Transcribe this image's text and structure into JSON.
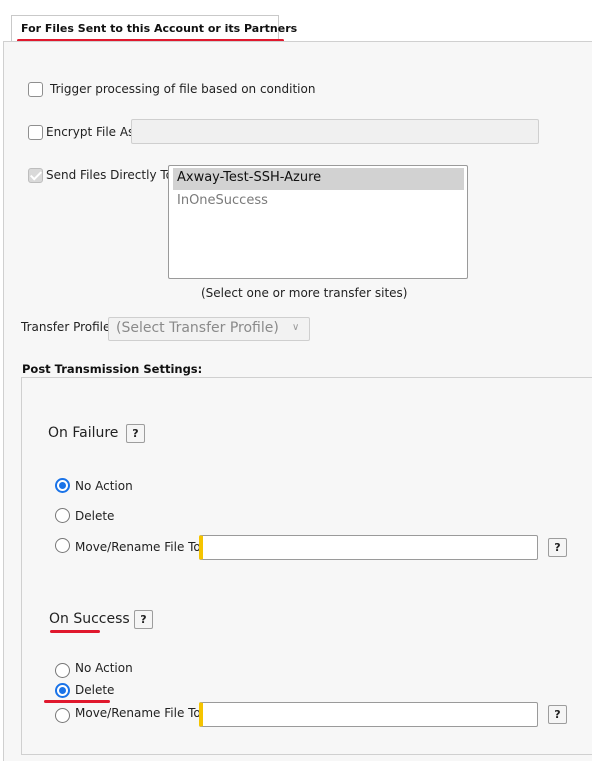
{
  "tab": {
    "label": "For Files Sent to this Account or its Partners"
  },
  "trigger": {
    "label": "Trigger processing of file based on condition",
    "checked": false
  },
  "encrypt": {
    "label": "Encrypt File As:",
    "checked": false,
    "value": ""
  },
  "send_directly": {
    "label": "Send Files Directly To:",
    "checked": true,
    "options": [
      "Axway-Test-SSH-Azure",
      "InOneSuccess"
    ],
    "selected": "Axway-Test-SSH-Azure",
    "hint": "(Select one or more transfer sites)"
  },
  "transfer_profile": {
    "label": "Transfer Profile:",
    "placeholder": "(Select Transfer Profile)"
  },
  "post_transmission": {
    "title": "Post Transmission Settings:",
    "on_failure": {
      "title": "On Failure",
      "help": "?",
      "options": [
        "No Action",
        "Delete",
        "Move/Rename File To:"
      ],
      "selected": "No Action",
      "move_value": "",
      "move_help": "?"
    },
    "on_success": {
      "title": "On Success",
      "help": "?",
      "options": [
        "No Action",
        "Delete",
        "Move/Rename File To:"
      ],
      "selected": "Delete",
      "move_value": "",
      "move_help": "?"
    }
  },
  "colors": {
    "annotation_red": "#e0182d",
    "radio_blue": "#1a73e8",
    "required_yellow": "#f5c400"
  }
}
